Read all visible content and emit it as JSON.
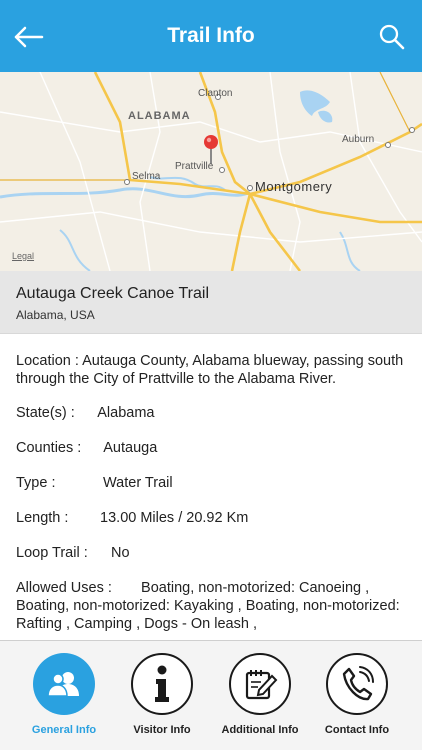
{
  "header": {
    "title": "Trail Info"
  },
  "map": {
    "labels": {
      "clanton": "Clanton",
      "alabama": "ALABAMA",
      "auburn": "Auburn",
      "selma": "Selma",
      "prattville": "Prattville",
      "montgomery": "Montgomery",
      "legal": "Legal"
    }
  },
  "trail": {
    "name": "Autauga Creek Canoe Trail",
    "location": "Alabama, USA"
  },
  "details": {
    "location_label": "Location  :",
    "location_value": "Autauga County, Alabama blueway, passing south through the City of Prattville to the Alabama River.",
    "states_label": "State(s) :",
    "states_value": "Alabama",
    "counties_label": "Counties :",
    "counties_value": "Autauga",
    "type_label": "Type :",
    "type_value": "Water Trail",
    "length_label": "Length :",
    "length_value": "13.00 Miles / 20.92 Km",
    "loop_label": "Loop Trail :",
    "loop_value": "No",
    "uses_label": "Allowed Uses :",
    "uses_value": "Boating, non-motorized: Canoeing , Boating, non-motorized: Kayaking , Boating, non-motorized: Rafting , Camping , Dogs - On leash ,"
  },
  "tabs": [
    {
      "label": "General Info",
      "icon": "users-icon",
      "active": true
    },
    {
      "label": "Visitor Info",
      "icon": "info-icon",
      "active": false
    },
    {
      "label": "Additional Info",
      "icon": "edit-document-icon",
      "active": false
    },
    {
      "label": "Contact Info",
      "icon": "phone-icon",
      "active": false
    }
  ],
  "colors": {
    "accent": "#2aa1e0",
    "road": "#f5c64a",
    "water": "#a9d3f2"
  }
}
